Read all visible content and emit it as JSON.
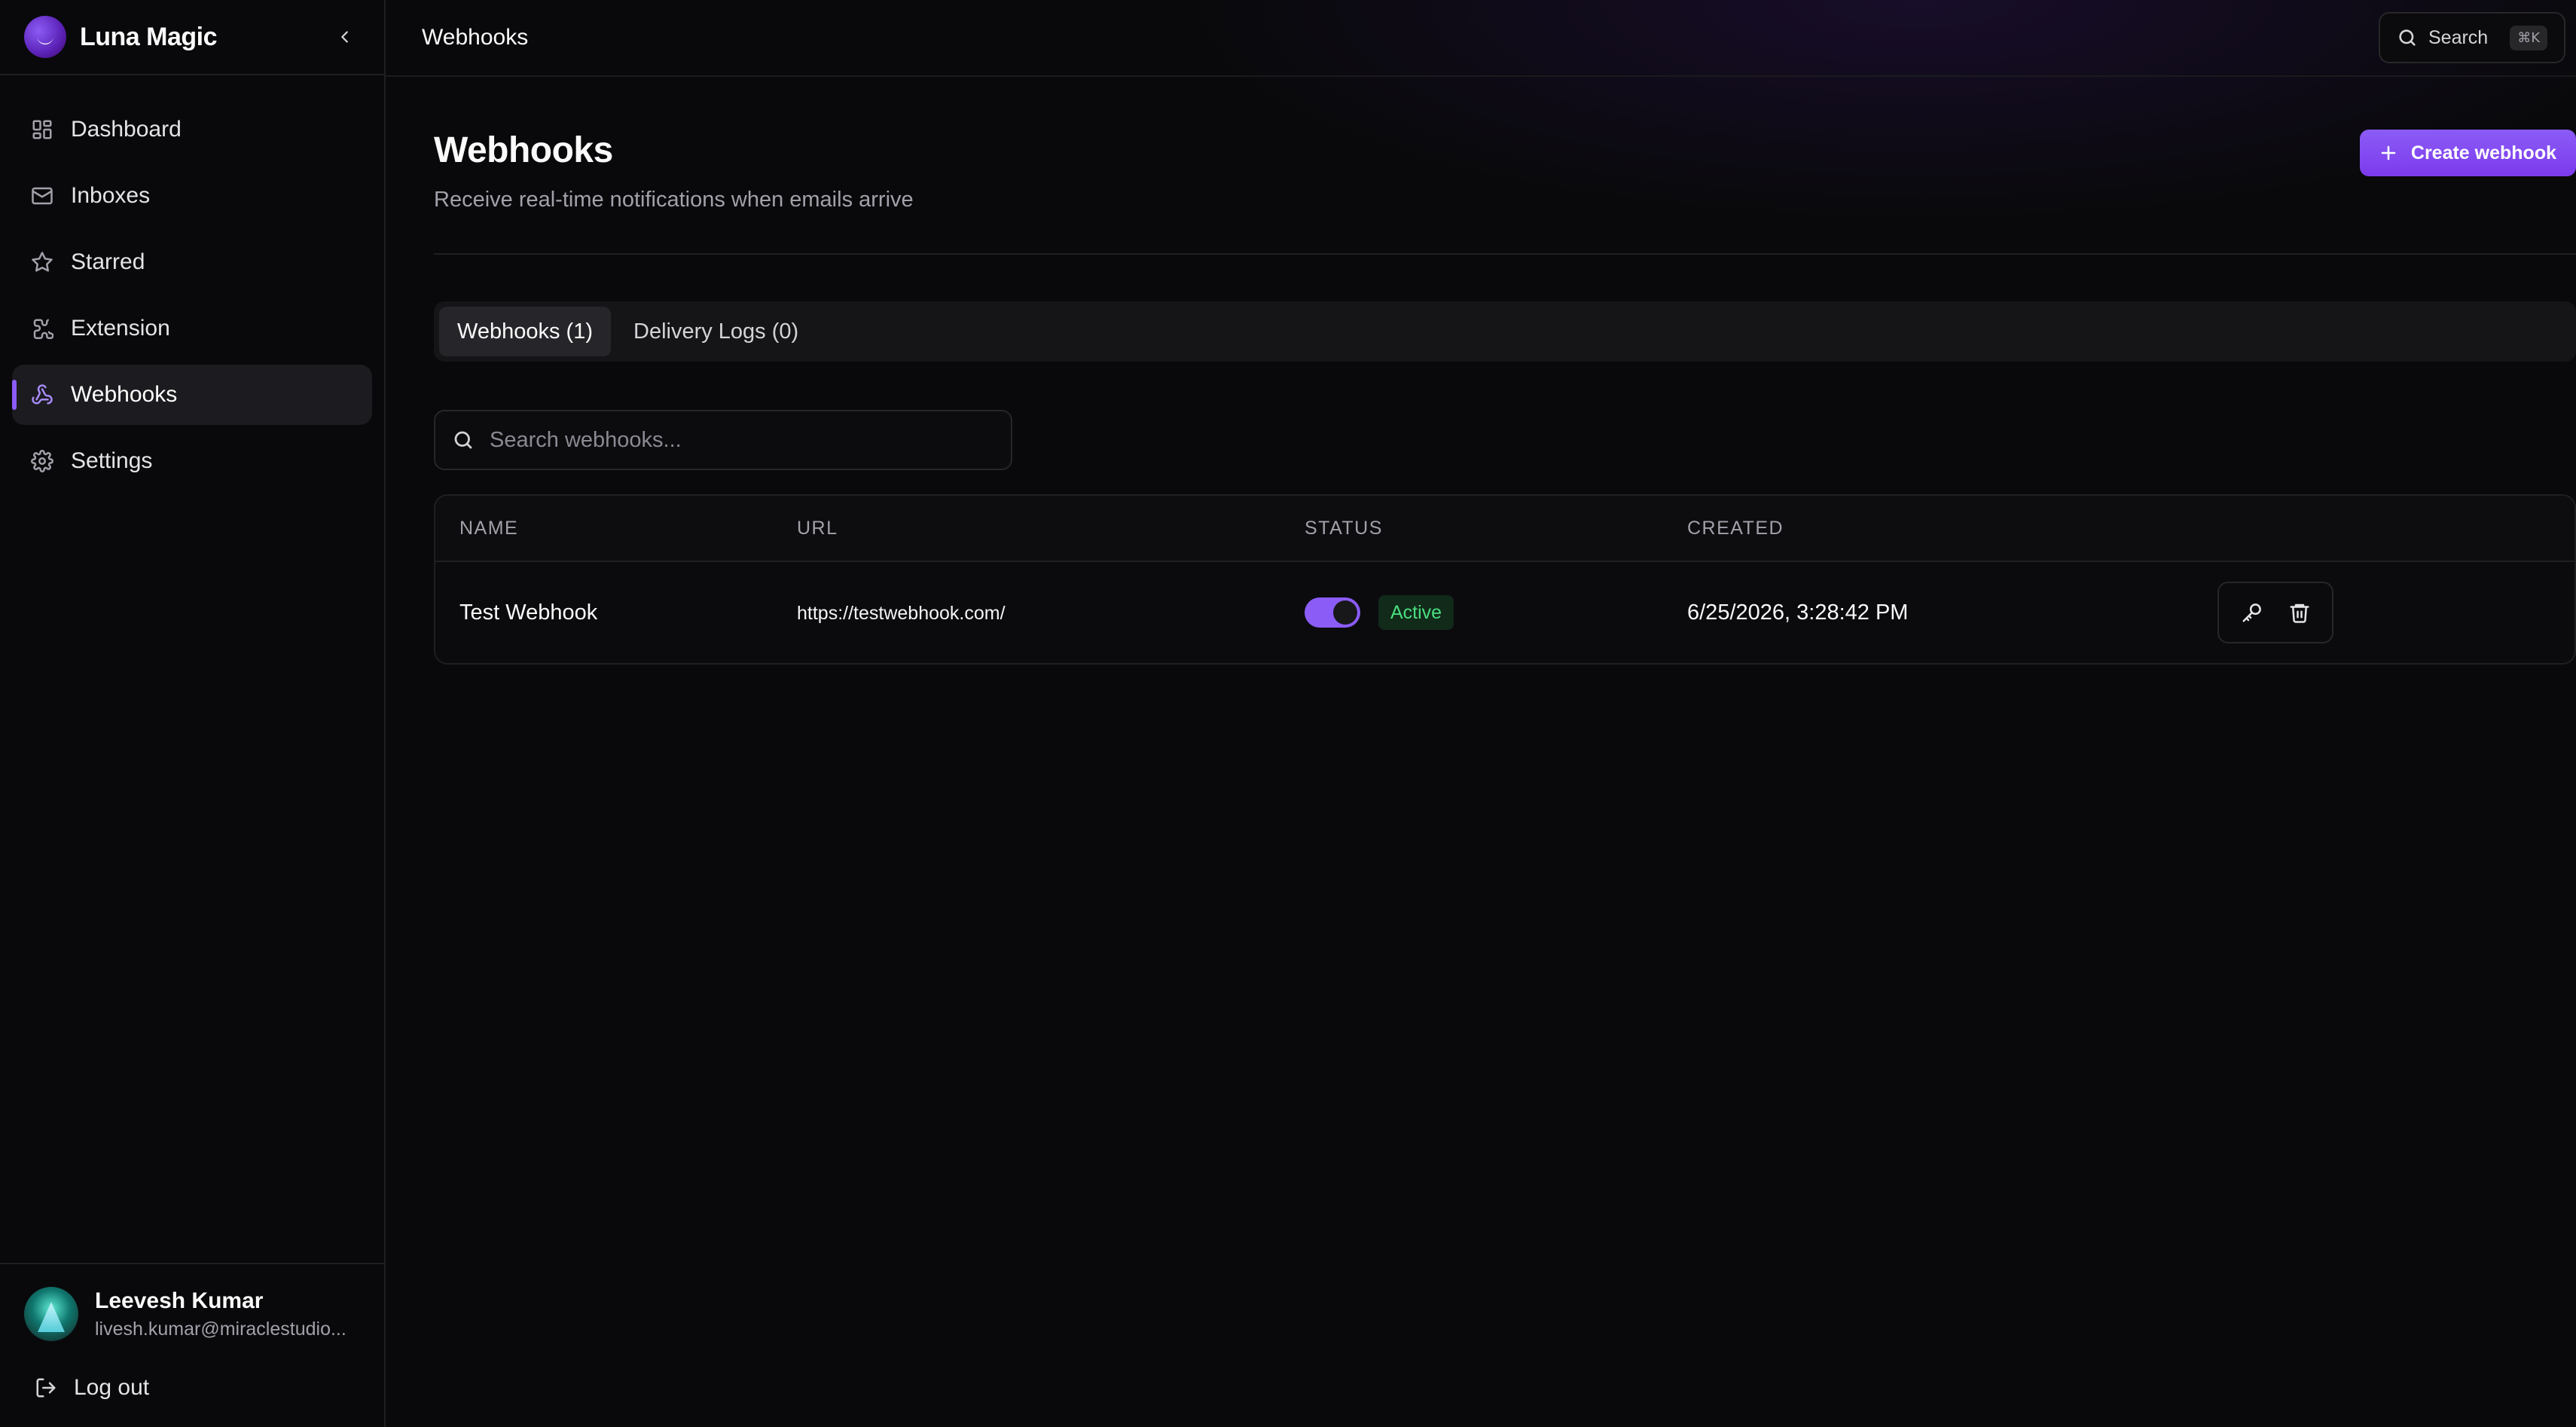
{
  "app": {
    "name": "Luna Magic"
  },
  "sidebar": {
    "items": [
      {
        "label": "Dashboard",
        "icon": "dashboard-icon"
      },
      {
        "label": "Inboxes",
        "icon": "mail-icon"
      },
      {
        "label": "Starred",
        "icon": "star-icon"
      },
      {
        "label": "Extension",
        "icon": "puzzle-icon"
      },
      {
        "label": "Webhooks",
        "icon": "webhook-icon",
        "active": true
      },
      {
        "label": "Settings",
        "icon": "gear-icon"
      }
    ],
    "user": {
      "name": "Leevesh Kumar",
      "email": "livesh.kumar@miraclestudio..."
    },
    "logout_label": "Log out"
  },
  "topbar": {
    "title": "Webhooks",
    "search_label": "Search",
    "search_shortcut": "⌘K"
  },
  "page": {
    "title": "Webhooks",
    "subtitle": "Receive real-time notifications when emails arrive",
    "create_label": "Create webhook"
  },
  "tabs": [
    {
      "label": "Webhooks (1)",
      "active": true
    },
    {
      "label": "Delivery Logs (0)",
      "active": false
    }
  ],
  "search": {
    "placeholder": "Search webhooks..."
  },
  "table": {
    "columns": [
      "NAME",
      "URL",
      "STATUS",
      "CREATED"
    ],
    "rows": [
      {
        "name": "Test Webhook",
        "url": "https://testwebhook.com/",
        "enabled": true,
        "status": "Active",
        "created": "6/25/2026, 3:28:42 PM"
      }
    ]
  },
  "colors": {
    "accent": "#8b5cf6",
    "background": "#09090b",
    "status_active": "#4ade80"
  }
}
